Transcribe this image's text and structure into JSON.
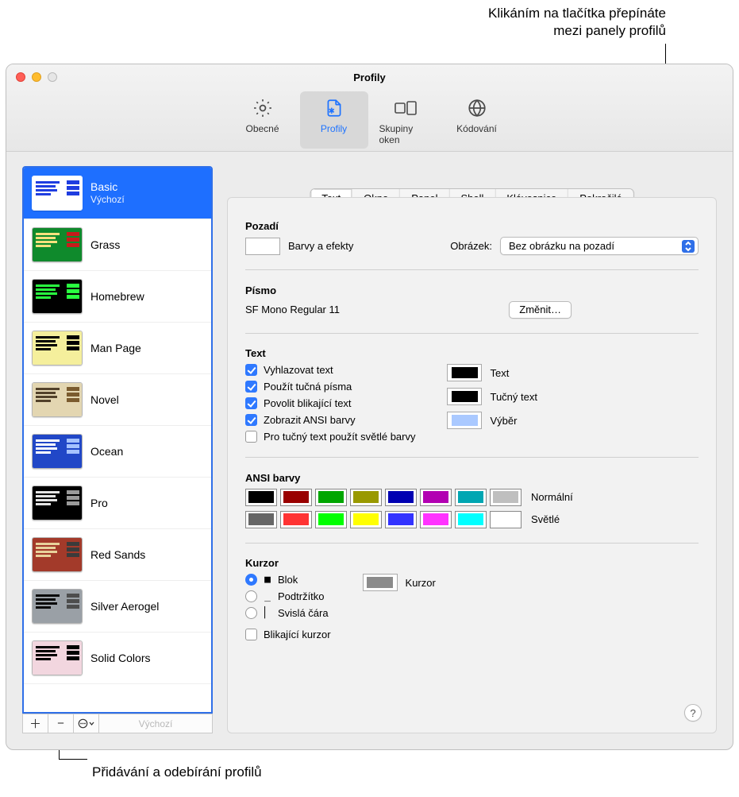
{
  "callouts": {
    "top": "Klikáním na tlačítka přepínáte\nmezi panely profilů",
    "bottom": "Přidávání a odebírání profilů"
  },
  "window": {
    "title": "Profily",
    "toolbar": [
      {
        "id": "general",
        "label": "Obecné"
      },
      {
        "id": "profiles",
        "label": "Profily",
        "active": true
      },
      {
        "id": "groups",
        "label": "Skupiny oken"
      },
      {
        "id": "encoding",
        "label": "Kódování"
      }
    ]
  },
  "sidebar": {
    "profiles": [
      {
        "name": "Basic",
        "sub": "Výchozí",
        "selected": true,
        "thumb": {
          "bg": "#ffffff",
          "text": "#1f3de0",
          "accent": "#1f3de0"
        }
      },
      {
        "name": "Grass",
        "thumb": {
          "bg": "#0f8a2c",
          "text": "#ffe17e",
          "accent": "#c71b1b"
        }
      },
      {
        "name": "Homebrew",
        "thumb": {
          "bg": "#000000",
          "text": "#29ff40",
          "accent": "#29ff40"
        }
      },
      {
        "name": "Man Page",
        "thumb": {
          "bg": "#f5ef9c",
          "text": "#000000",
          "accent": "#000000"
        }
      },
      {
        "name": "Novel",
        "thumb": {
          "bg": "#e3d6b1",
          "text": "#52412a",
          "accent": "#7a5b2e"
        }
      },
      {
        "name": "Ocean",
        "thumb": {
          "bg": "#2147c7",
          "text": "#ffffff",
          "accent": "#a5c2ff"
        }
      },
      {
        "name": "Pro",
        "thumb": {
          "bg": "#000000",
          "text": "#e4e4e4",
          "accent": "#9a9a9a"
        }
      },
      {
        "name": "Red Sands",
        "thumb": {
          "bg": "#a33a2a",
          "text": "#e8d29b",
          "accent": "#3b3b3b"
        }
      },
      {
        "name": "Silver Aerogel",
        "thumb": {
          "bg": "#9aa0a6",
          "text": "#0a0a0a",
          "accent": "#4d4d4d"
        }
      },
      {
        "name": "Solid Colors",
        "thumb": {
          "bg": "#f2d6df",
          "text": "#000000",
          "accent": "#000000"
        }
      }
    ],
    "footer": {
      "default": "Výchozí"
    }
  },
  "segmented": [
    {
      "id": "text",
      "label": "Text",
      "active": true
    },
    {
      "id": "window",
      "label": "Okno"
    },
    {
      "id": "panel",
      "label": "Panel"
    },
    {
      "id": "shell",
      "label": "Shell"
    },
    {
      "id": "keyboard",
      "label": "Klávesnice"
    },
    {
      "id": "advanced",
      "label": "Pokročilé"
    }
  ],
  "sections": {
    "background": {
      "title": "Pozadí",
      "colorsEffects": "Barvy a efekty",
      "bgColor": "#ffffff",
      "imageLabel": "Obrázek:",
      "imageValue": "Bez obrázku na pozadí"
    },
    "font": {
      "title": "Písmo",
      "value": "SF Mono Regular 11",
      "change": "Změnit…"
    },
    "text": {
      "title": "Text",
      "checks": [
        {
          "label": "Vyhlazovat text",
          "checked": true
        },
        {
          "label": "Použít tučná písma",
          "checked": true
        },
        {
          "label": "Povolit blikající text",
          "checked": true
        },
        {
          "label": "Zobrazit ANSI barvy",
          "checked": true
        },
        {
          "label": "Pro tučný text použít světlé barvy",
          "checked": false
        }
      ],
      "wells": [
        {
          "label": "Text",
          "color": "#000000"
        },
        {
          "label": "Tučný text",
          "color": "#000000"
        },
        {
          "label": "Výběr",
          "color": "#aac9ff"
        }
      ]
    },
    "ansi": {
      "title": "ANSI barvy",
      "rows": [
        {
          "label": "Normální",
          "colors": [
            "#000000",
            "#990000",
            "#00a600",
            "#999900",
            "#0000b2",
            "#b200b2",
            "#00a6b2",
            "#bfbfbf"
          ]
        },
        {
          "label": "Světlé",
          "colors": [
            "#666666",
            "#ff3333",
            "#00ff00",
            "#ffff00",
            "#3333ff",
            "#ff33ff",
            "#00ffff",
            "#ffffff"
          ]
        }
      ]
    },
    "cursor": {
      "title": "Kurzor",
      "options": [
        {
          "label": "Blok",
          "glyph": "■",
          "checked": true
        },
        {
          "label": "Podtržítko",
          "glyph": "_",
          "checked": false
        },
        {
          "label": "Svislá čára",
          "glyph": "▏",
          "checked": false
        }
      ],
      "blink": {
        "label": "Blikající kurzor",
        "checked": false
      },
      "well": {
        "label": "Kurzor",
        "color": "#8b8b8b"
      }
    }
  }
}
